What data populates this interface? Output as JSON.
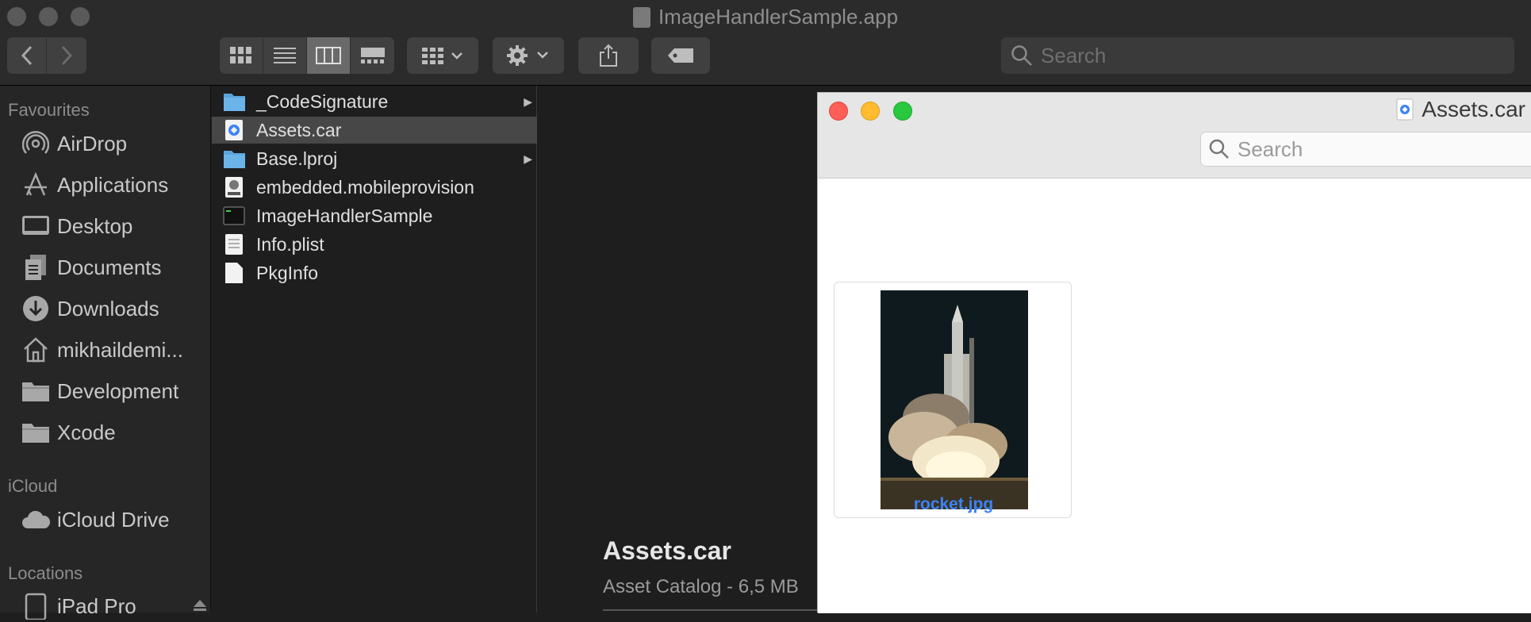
{
  "window": {
    "title": "ImageHandlerSample.app"
  },
  "toolbar": {
    "back_label": "Back",
    "forward_label": "Forward",
    "search_placeholder": "Search"
  },
  "sidebar": {
    "favourites_header": "Favourites",
    "favourites": [
      {
        "label": "AirDrop",
        "icon": "airdrop-icon"
      },
      {
        "label": "Applications",
        "icon": "applications-icon"
      },
      {
        "label": "Desktop",
        "icon": "desktop-icon"
      },
      {
        "label": "Documents",
        "icon": "documents-icon"
      },
      {
        "label": "Downloads",
        "icon": "downloads-icon"
      },
      {
        "label": "mikhaildemi...",
        "icon": "home-icon"
      },
      {
        "label": "Development",
        "icon": "folder-icon"
      },
      {
        "label": "Xcode",
        "icon": "folder-icon"
      }
    ],
    "icloud_header": "iCloud",
    "icloud": [
      {
        "label": "iCloud Drive",
        "icon": "cloud-icon"
      }
    ],
    "locations_header": "Locations",
    "locations": [
      {
        "label": "iPad Pro",
        "icon": "ipad-icon"
      }
    ]
  },
  "files": [
    {
      "name": "_CodeSignature",
      "type": "folder",
      "has_children": true
    },
    {
      "name": "Assets.car",
      "type": "asset-catalog",
      "selected": true
    },
    {
      "name": "Base.lproj",
      "type": "folder",
      "has_children": true
    },
    {
      "name": "embedded.mobileprovision",
      "type": "provision"
    },
    {
      "name": "ImageHandlerSample",
      "type": "executable"
    },
    {
      "name": "Info.plist",
      "type": "plist"
    },
    {
      "name": "PkgInfo",
      "type": "document"
    }
  ],
  "preview": {
    "name": "Assets.car",
    "info": "Asset Catalog - 6,5 MB"
  },
  "quicklook": {
    "title": "Assets.car",
    "search_placeholder": "Search",
    "items": [
      {
        "caption": "rocket.jpg"
      }
    ]
  },
  "colors": {
    "close": "#fe5f57",
    "minimize": "#febc2e",
    "zoom": "#28c840",
    "link": "#3b82f6"
  }
}
